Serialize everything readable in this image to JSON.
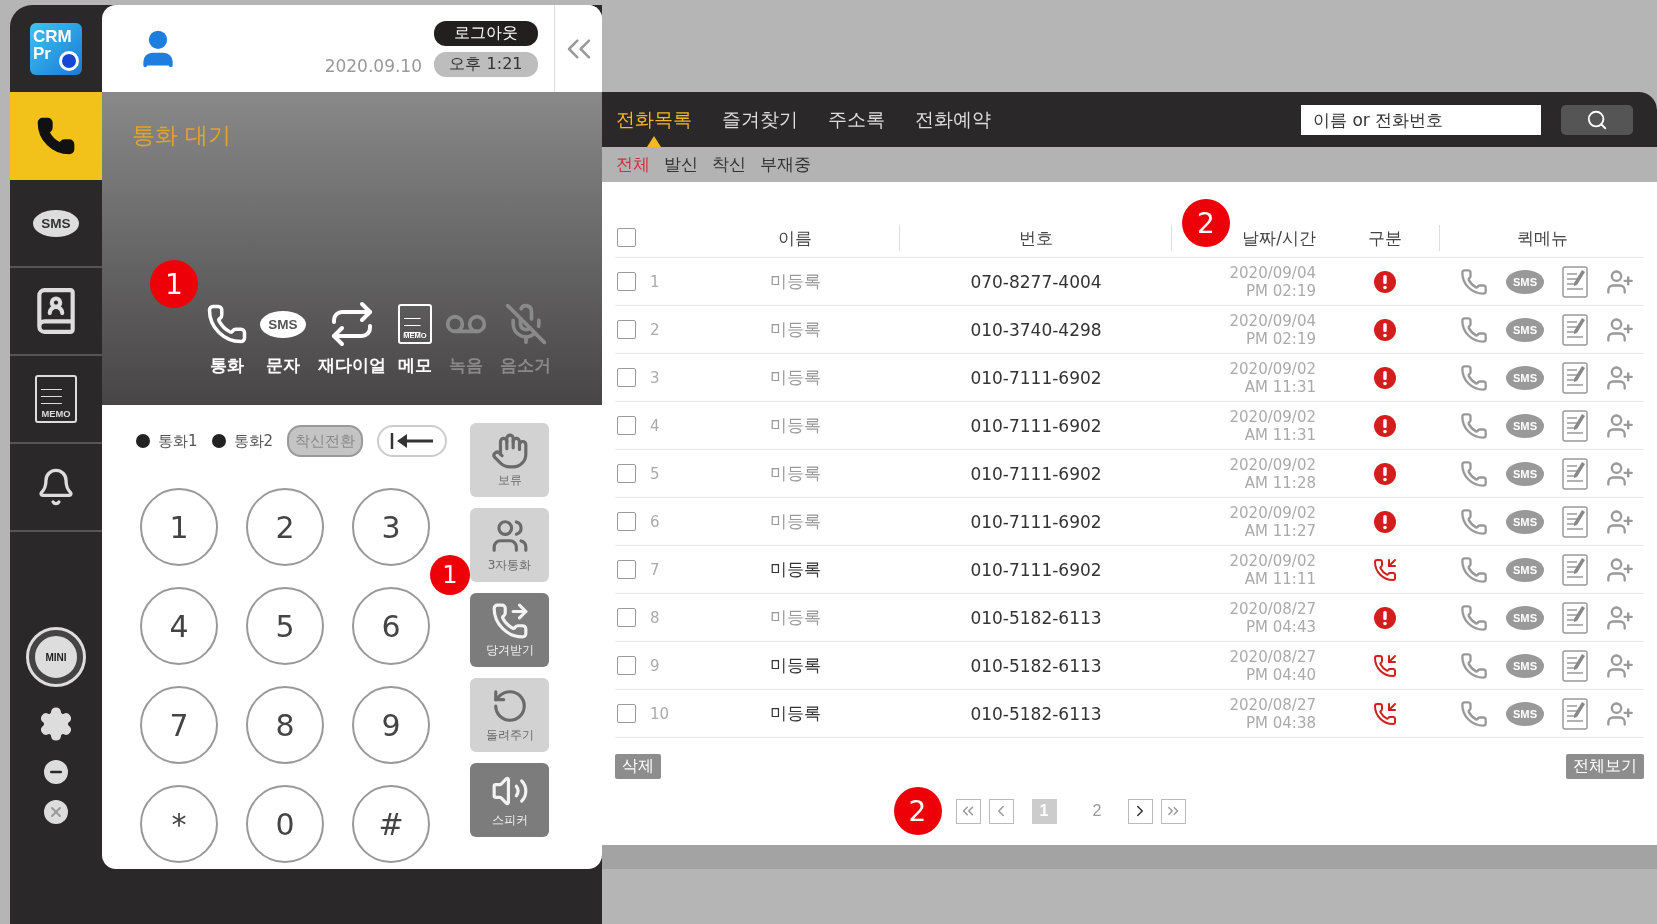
{
  "sidebar": {
    "logo": {
      "line1": "CRM",
      "line2": "Pr"
    },
    "items": [
      {
        "kind": "phone",
        "selected": true
      },
      {
        "kind": "sms",
        "label": "SMS",
        "selected": false
      },
      {
        "kind": "contacts",
        "selected": false
      },
      {
        "kind": "memo",
        "label": "MEMO",
        "selected": false
      },
      {
        "kind": "bell",
        "selected": false
      }
    ],
    "bottom": [
      {
        "kind": "mini",
        "label": "MINI"
      },
      {
        "kind": "settings"
      },
      {
        "kind": "minimize"
      },
      {
        "kind": "close"
      }
    ]
  },
  "phone_panel": {
    "header": {
      "date": "2020.09.10",
      "time": "오후 1:21",
      "logout": "로그아웃"
    },
    "status": "통화 대기",
    "badge": "1",
    "actions": [
      {
        "kind": "call",
        "label": "통화",
        "disabled": false
      },
      {
        "kind": "sms",
        "label": "문자",
        "icon_text": "SMS",
        "disabled": false
      },
      {
        "kind": "redial",
        "label": "재다이얼",
        "disabled": false
      },
      {
        "kind": "memo",
        "label": "메모",
        "icon_text": "MEMO",
        "disabled": false
      },
      {
        "kind": "record",
        "label": "녹음",
        "disabled": true
      },
      {
        "kind": "mute",
        "label": "음소거",
        "disabled": true
      }
    ],
    "lines": [
      {
        "label": "통화1"
      },
      {
        "label": "통화2"
      }
    ],
    "forward_button": "착신전환",
    "keypad": [
      "1",
      "2",
      "3",
      "4",
      "5",
      "6",
      "7",
      "8",
      "9",
      "*",
      "0",
      "#"
    ],
    "keypad_badge": "1",
    "side_buttons": [
      {
        "kind": "hold",
        "label": "보류",
        "disabled": true
      },
      {
        "kind": "conference",
        "label": "3자통화",
        "disabled": true
      },
      {
        "kind": "pickup",
        "label": "당겨받기",
        "disabled": false
      },
      {
        "kind": "return",
        "label": "돌려주기",
        "disabled": true
      },
      {
        "kind": "speaker",
        "label": "스피커",
        "disabled": false
      }
    ]
  },
  "call_list": {
    "tabs": [
      {
        "label": "전화목록",
        "selected": true
      },
      {
        "label": "즐겨찾기",
        "selected": false
      },
      {
        "label": "주소록",
        "selected": false
      },
      {
        "label": "전화예약",
        "selected": false
      }
    ],
    "search": {
      "placeholder": "이름 or 전화번호"
    },
    "filters": [
      {
        "label": "전체",
        "selected": true
      },
      {
        "label": "발신",
        "selected": false
      },
      {
        "label": "착신",
        "selected": false
      },
      {
        "label": "부재중",
        "selected": false
      }
    ],
    "badge": "2",
    "table": {
      "columns": [
        "이름",
        "번호",
        "날짜/시간",
        "구분",
        "퀵메뉴"
      ],
      "header_checked": false,
      "rows": [
        {
          "no": "1",
          "name": "미등록",
          "highlighted": false,
          "number": "070-8277-4004",
          "date": "2020/09/04",
          "time": "PM 02:19",
          "kind": "missed",
          "sms": "SMS",
          "checked": false
        },
        {
          "no": "2",
          "name": "미등록",
          "highlighted": false,
          "number": "010-3740-4298",
          "date": "2020/09/04",
          "time": "PM 02:19",
          "kind": "missed",
          "sms": "SMS",
          "checked": false
        },
        {
          "no": "3",
          "name": "미등록",
          "highlighted": false,
          "number": "010-7111-6902",
          "date": "2020/09/02",
          "time": "AM 11:31",
          "kind": "missed",
          "sms": "SMS",
          "checked": false
        },
        {
          "no": "4",
          "name": "미등록",
          "highlighted": false,
          "number": "010-7111-6902",
          "date": "2020/09/02",
          "time": "AM 11:31",
          "kind": "missed",
          "sms": "SMS",
          "checked": false
        },
        {
          "no": "5",
          "name": "미등록",
          "highlighted": false,
          "number": "010-7111-6902",
          "date": "2020/09/02",
          "time": "AM 11:28",
          "kind": "missed",
          "sms": "SMS",
          "checked": false
        },
        {
          "no": "6",
          "name": "미등록",
          "highlighted": false,
          "number": "010-7111-6902",
          "date": "2020/09/02",
          "time": "AM 11:27",
          "kind": "missed",
          "sms": "SMS",
          "checked": false
        },
        {
          "no": "7",
          "name": "미등록",
          "highlighted": true,
          "number": "010-7111-6902",
          "date": "2020/09/02",
          "time": "AM 11:11",
          "kind": "incoming",
          "sms": "SMS",
          "checked": false
        },
        {
          "no": "8",
          "name": "미등록",
          "highlighted": false,
          "number": "010-5182-6113",
          "date": "2020/08/27",
          "time": "PM 04:43",
          "kind": "missed",
          "sms": "SMS",
          "checked": false
        },
        {
          "no": "9",
          "name": "미등록",
          "highlighted": true,
          "number": "010-5182-6113",
          "date": "2020/08/27",
          "time": "PM 04:40",
          "kind": "incoming",
          "sms": "SMS",
          "checked": false
        },
        {
          "no": "10",
          "name": "미등록",
          "highlighted": true,
          "number": "010-5182-6113",
          "date": "2020/08/27",
          "time": "PM 04:38",
          "kind": "incoming",
          "sms": "SMS",
          "checked": false
        }
      ]
    },
    "delete_button": "삭제",
    "view_all_button": "전체보기",
    "pagination": {
      "badge": "2",
      "pages": [
        {
          "label": "1",
          "selected": true
        },
        {
          "label": "2",
          "selected": false
        }
      ]
    }
  }
}
